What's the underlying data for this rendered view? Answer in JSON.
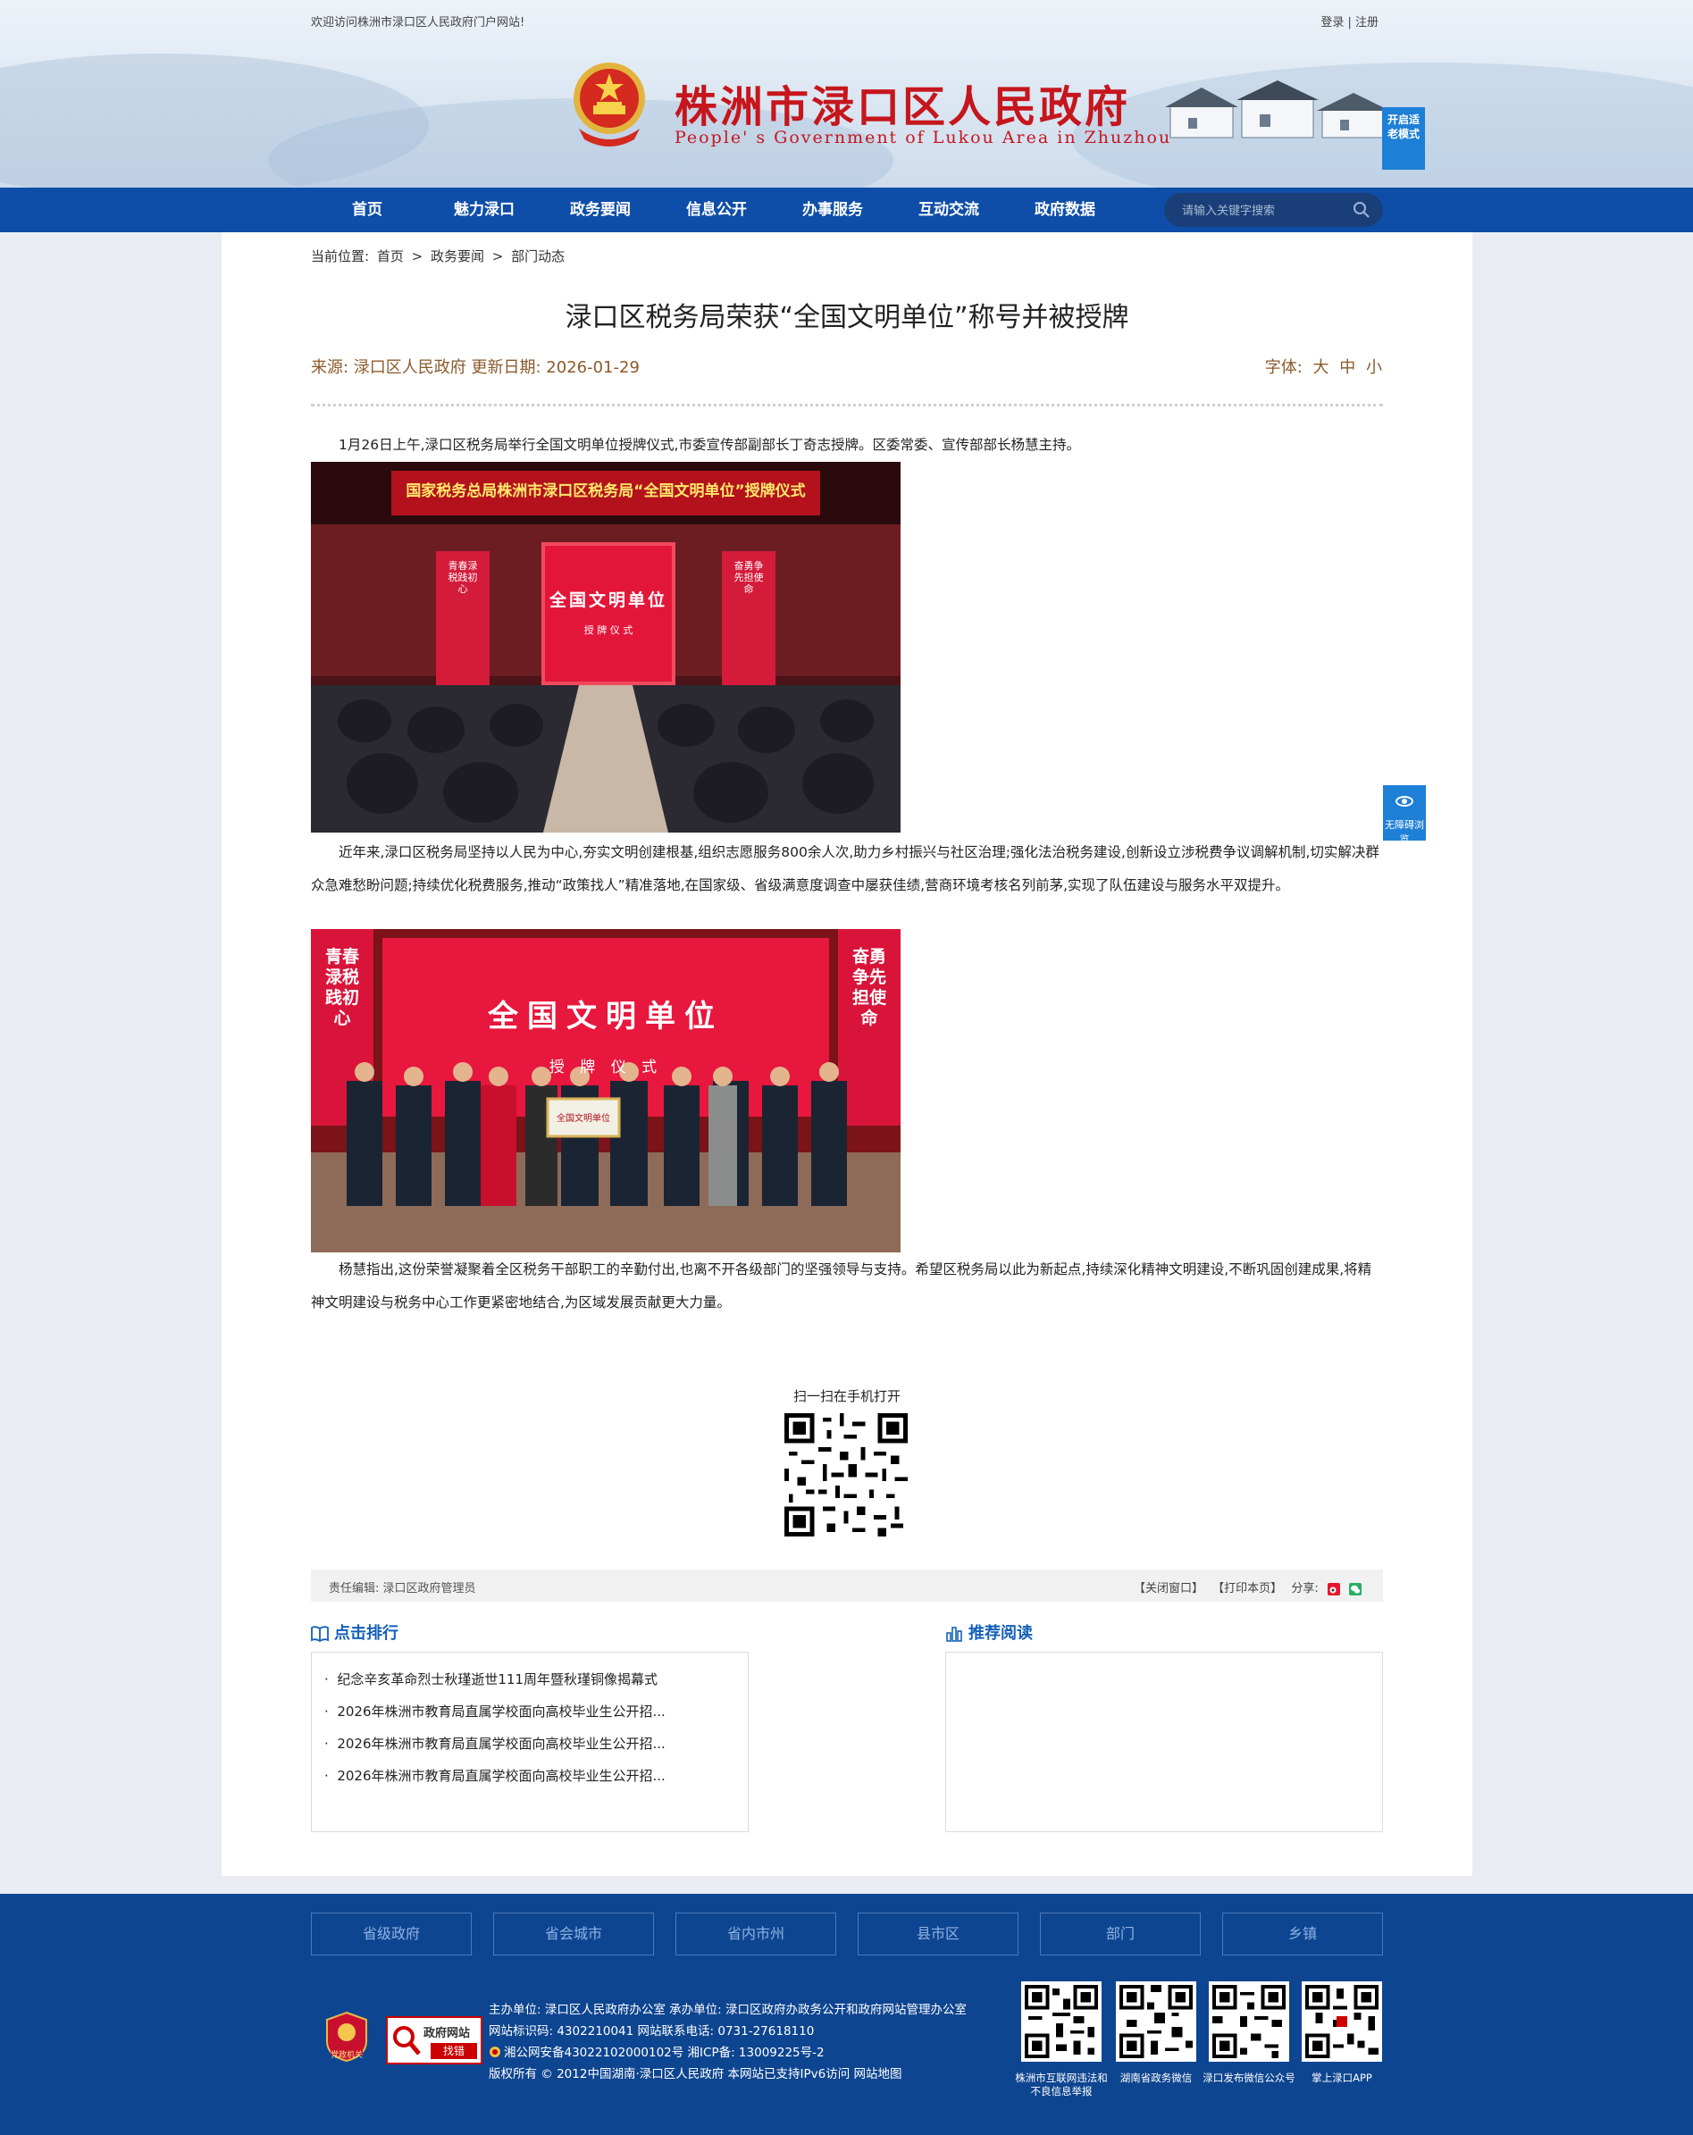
{
  "header": {
    "welcome": "欢迎访问株洲市渌口区人民政府门户网站!",
    "login": "登录",
    "register": "注册",
    "site_title": "株洲市渌口区人民政府",
    "site_subtitle": "People' s Government of Lukou Area in Zhuzhou",
    "elder_mode": "开启适老模式",
    "colors": {
      "title_red": "#c6161d",
      "nav_blue": "#0e4ea8",
      "accent_blue": "#1e7fd6"
    }
  },
  "nav": {
    "items": [
      "首页",
      "魅力渌口",
      "政务要闻",
      "信息公开",
      "办事服务",
      "互动交流",
      "政府数据"
    ],
    "search_placeholder": "请输入关键字搜索"
  },
  "breadcrumb": {
    "prefix": "当前位置:",
    "items": [
      "首页",
      "政务要闻",
      "部门动态"
    ],
    "sep": ">"
  },
  "article": {
    "title": "渌口区税务局荣获“全国文明单位”称号并被授牌",
    "meta": "来源:  渌口区人民政府 更新日期:  2026-01-29",
    "font_label": "字体:",
    "font_sizes": [
      "大",
      "中",
      "小"
    ],
    "paragraphs": [
      "1月26日上午,渌口区税务局举行全国文明单位授牌仪式,市委宣传部副部长丁奇志授牌。区委常委、宣传部部长杨慧主持。",
      "近年来,渌口区税务局坚持以人民为中心,夯实文明创建根基,组织志愿服务800余人次,助力乡村振兴与社区治理;强化法治税务建设,创新设立涉税费争议调解机制,切实解决群众急难愁盼问题;持续优化税费服务,推动“政策找人”精准落地,在国家级、省级满意度调查中屡获佳绩,营商环境考核名列前茅,实现了队伍建设与服务水平双提升。",
      "杨慧指出,这份荣誉凝聚着全区税务干部职工的辛勤付出,也离不开各级部门的坚强领导与支持。希望区税务局以此为新起点,持续深化精神文明建设,不断巩固创建成果,将精神文明建设与税务中心工作更紧密地结合,为区域发展贡献更大力量。"
    ],
    "photo1_banner": "国家税务总局株洲市渌口区税务局“全国文明单位”授牌仪式",
    "photo1_screen_title": "全国文明单位",
    "photo1_screen_sub": "授 牌 仪 式",
    "photo1_left_banner": "青春渌税践初心",
    "photo1_right_banner": "奋勇争先担使命",
    "photo2_screen_title": "全国文明单位",
    "photo2_screen_sub": "授 牌 仪 式",
    "photo2_plaque": "全国文明单位",
    "photo2_left_banner": "青春渌税践初心",
    "photo2_right_banner": "奋勇争先担使命"
  },
  "accessibility": {
    "label": "无障碍浏览"
  },
  "qr": {
    "label": "扫一扫在手机打开"
  },
  "editor_bar": {
    "editor": "责任编辑:  渌口区政府管理员",
    "close": "【关闭窗口】",
    "print": "【打印本页】",
    "share": "分享:"
  },
  "ranking": {
    "title": "点击排行",
    "items": [
      "纪念辛亥革命烈士秋瑾逝世111周年暨秋瑾铜像揭幕式",
      "2026年株洲市教育局直属学校面向高校毕业生公开招...",
      "2026年株洲市教育局直属学校面向高校毕业生公开招...",
      "2026年株洲市教育局直属学校面向高校毕业生公开招..."
    ]
  },
  "recommend": {
    "title": "推荐阅读"
  },
  "footer": {
    "links": [
      "省级政府",
      "省会城市",
      "省内市州",
      "县市区",
      "部门",
      "乡镇"
    ],
    "info": [
      "主办单位:  渌口区人民政府办公室 承办单位:  渌口区政府办政务公开和政府网站管理办公室",
      "网站标识码:  4302210041 网站联系电话:  0731-27618110",
      "湘公网安备43022102000102号 湘ICP备:  13009225号-2",
      "版权所有 © 2012中国湖南·渌口区人民政府 本网站已支持IPv6访问 网站地图"
    ],
    "badge1": "党政机关",
    "badge2_top": "政府网站",
    "badge2_bottom": "找错",
    "qr_captions": [
      "株洲市互联网违法和不良信息举报",
      "湖南省政务微信",
      "渌口发布微信公众号",
      "掌上渌口APP"
    ]
  }
}
